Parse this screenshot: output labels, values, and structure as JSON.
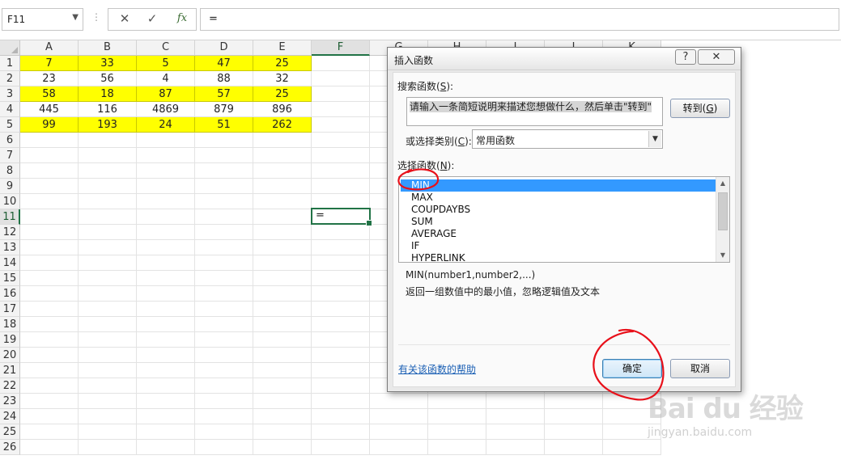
{
  "formula_bar": {
    "name_box": "F11",
    "cancel_glyph": "✕",
    "enter_glyph": "✓",
    "fx_label": "fx",
    "formula": "="
  },
  "grid": {
    "columns": [
      "A",
      "B",
      "C",
      "D",
      "E",
      "F",
      "G",
      "H",
      "I",
      "J",
      "K"
    ],
    "rows": [
      "1",
      "2",
      "3",
      "4",
      "5",
      "6",
      "7",
      "8",
      "9",
      "10",
      "11",
      "12",
      "13",
      "14",
      "15",
      "16",
      "17",
      "18",
      "19",
      "20",
      "21",
      "22",
      "23",
      "24",
      "25",
      "26"
    ],
    "selected_column": "F",
    "selected_row": "11",
    "highlight_color": "#ffff00",
    "data": [
      [
        "7",
        "33",
        "5",
        "47",
        "25"
      ],
      [
        "23",
        "56",
        "4",
        "88",
        "32"
      ],
      [
        "58",
        "18",
        "87",
        "57",
        "25"
      ],
      [
        "445",
        "116",
        "4869",
        "879",
        "896"
      ],
      [
        "99",
        "193",
        "24",
        "51",
        "262"
      ]
    ],
    "highlighted_rows": [
      1,
      3,
      5
    ],
    "active_cell_value": "="
  },
  "dialog": {
    "title": "插入函数",
    "help_button": "?",
    "close_button": "✕",
    "search_label": "搜索函数(",
    "search_key": "S",
    "search_label_end": "):",
    "search_text": "请输入一条简短说明来描述您想做什么，然后单击\"转到\"",
    "goto_button": "转到(",
    "goto_key": "G",
    "goto_end": ")",
    "category_label": "或选择类别(",
    "category_key": "C",
    "category_end": "):",
    "category_value": "常用函数",
    "select_label": "选择函数(",
    "select_key": "N",
    "select_end": "):",
    "functions": [
      "MIN",
      "MAX",
      "COUPDAYBS",
      "SUM",
      "AVERAGE",
      "IF",
      "HYPERLINK"
    ],
    "selected_function": "MIN",
    "signature": "MIN(number1,number2,...)",
    "description": "返回一组数值中的最小值，忽略逻辑值及文本",
    "help_link": "有关该函数的帮助",
    "ok_button": "确定",
    "cancel_button": "取消"
  },
  "watermark": {
    "brand": "Bai du 经验",
    "url": "jingyan.baidu.com"
  },
  "colors": {
    "selection_green": "#217346",
    "list_selection": "#3399ff",
    "annotation_red": "#e8101a"
  }
}
